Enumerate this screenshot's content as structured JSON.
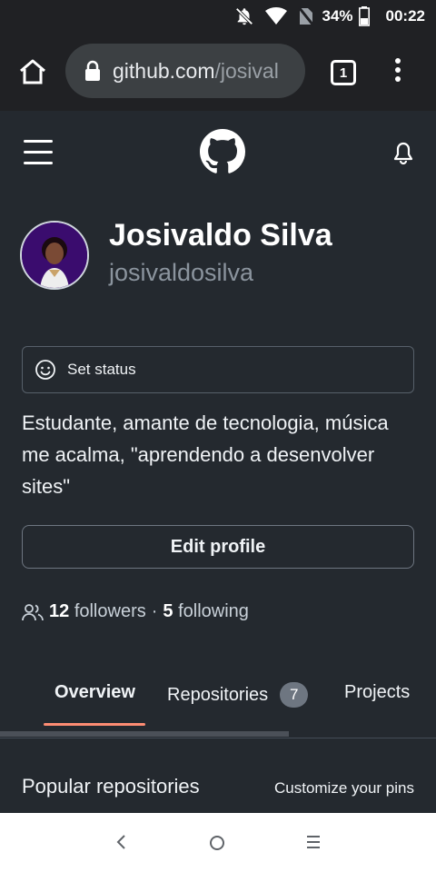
{
  "status_bar": {
    "icons": [
      "notifications-off-icon",
      "wifi-icon",
      "no-sim-icon",
      "battery-icon"
    ],
    "battery": "34%",
    "time": "00:22"
  },
  "browser": {
    "url_host": "github.com",
    "url_path": "/josival",
    "tab_count": "1"
  },
  "profile": {
    "name": "Josivaldo Silva",
    "login": "josivaldosilva",
    "status_label": "Set status",
    "bio": "Estudante, amante de tecnologia, música me acalma, \"aprendendo a desenvolver sites\"",
    "edit_label": "Edit profile",
    "followers_count": "12",
    "followers_label": "followers",
    "separator": "·",
    "following_count": "5",
    "following_label": "following"
  },
  "tabs": {
    "overview": "Overview",
    "repositories": "Repositories",
    "repositories_count": "7",
    "projects": "Projects"
  },
  "popular": {
    "title": "Popular repositories",
    "customize": "Customize your pins"
  },
  "colors": {
    "background": "#24292f",
    "selected_tab_underline": "#fd8c73",
    "status_bar": "#202124"
  }
}
